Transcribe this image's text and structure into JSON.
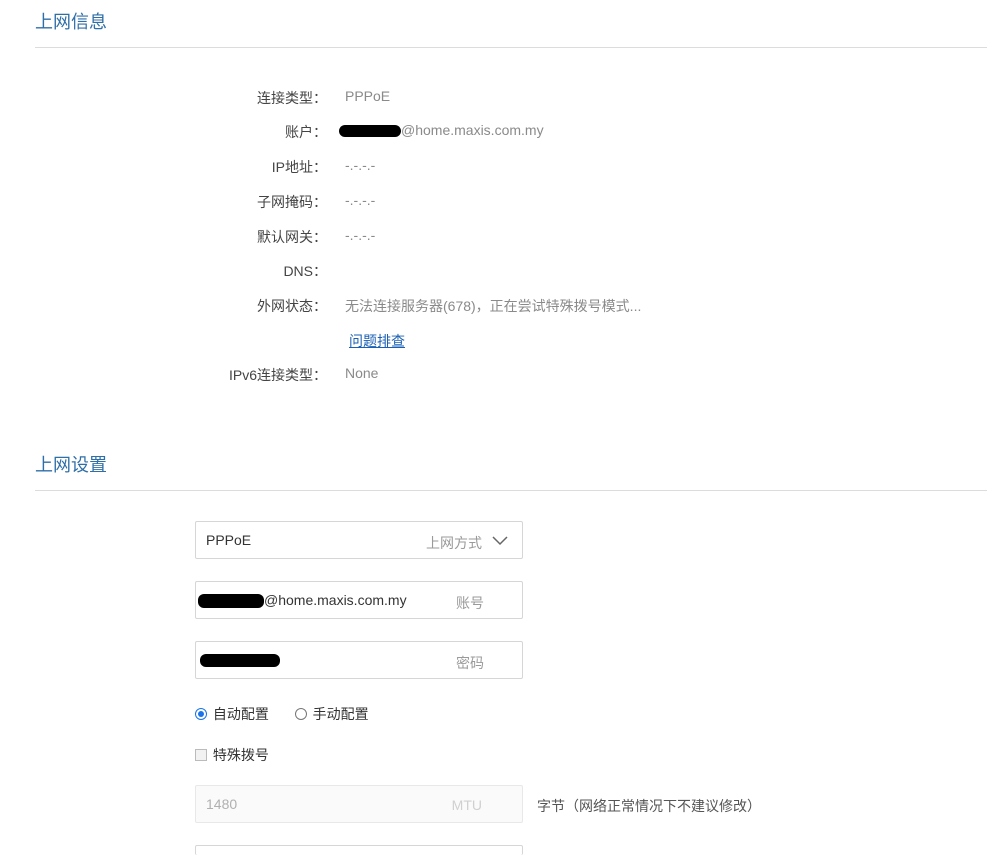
{
  "info_section": {
    "title": "上网信息",
    "rows": [
      {
        "label": "连接类型：",
        "value": "PPPoE"
      },
      {
        "label": "账户：",
        "value": "@home.maxis.com.my"
      },
      {
        "label": "IP地址：",
        "value": "-.-.-.-"
      },
      {
        "label": "子网掩码：",
        "value": "-.-.-.-"
      },
      {
        "label": "默认网关：",
        "value": "-.-.-.-"
      },
      {
        "label": "DNS：",
        "value": ""
      },
      {
        "label": "外网状态：",
        "value": "无法连接服务器(678)，正在尝试特殊拨号模式..."
      }
    ],
    "troubleshoot_link": "问题排查",
    "ipv6": {
      "label": "IPv6连接类型：",
      "value": "None"
    }
  },
  "settings_section": {
    "title": "上网设置",
    "mode": {
      "value": "PPPoE",
      "hint": "上网方式"
    },
    "account": {
      "value": "@home.maxis.com.my",
      "hint": "账号"
    },
    "password": {
      "hint": "密码"
    },
    "auto_config": "自动配置",
    "manual_config": "手动配置",
    "special_dial": "特殊拨号",
    "mtu": {
      "value": "1480",
      "hint": "MTU",
      "note": "字节（网络正常情况下不建议修改）"
    }
  },
  "colors": {
    "accent": "#2f6fa8",
    "link": "#1a5fb4",
    "radio": "#1a73e8"
  }
}
